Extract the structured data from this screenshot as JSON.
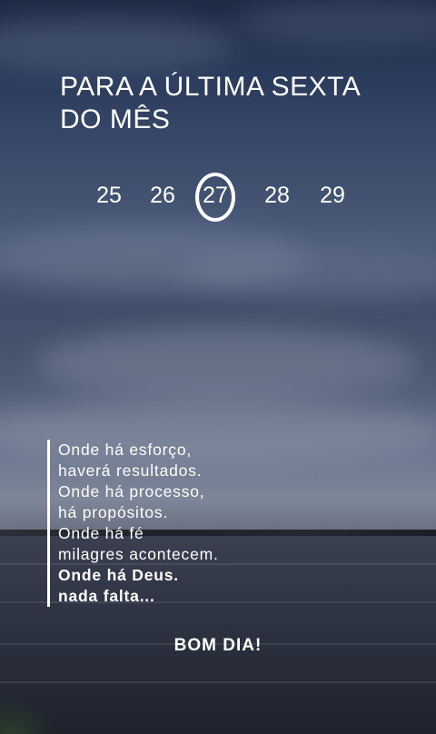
{
  "title": {
    "line1": "PARA A ÚLTIMA SEXTA",
    "line2": "DO MÊS"
  },
  "dates": [
    "25",
    "26",
    "27",
    "28",
    "29"
  ],
  "highlighted_date": "27",
  "quote": {
    "lines": [
      "Onde há esforço,",
      "haverá resultados.",
      "Onde há processo,",
      "há propósitos.",
      "Onde há fé",
      "milagres acontecem."
    ],
    "bold_lines": [
      "Onde há Deus.",
      "nada falta..."
    ]
  },
  "footer": "BOM DIA!"
}
